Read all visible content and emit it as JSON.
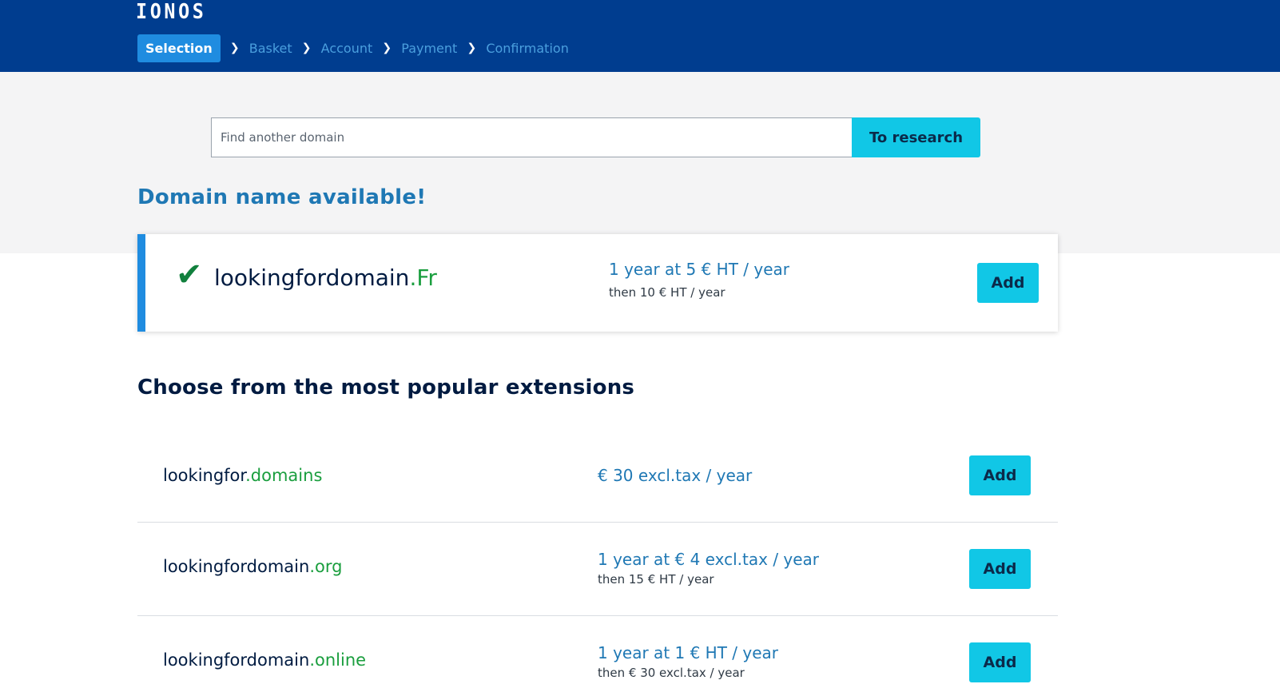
{
  "header": {
    "logo": "IONOS",
    "steps": [
      {
        "label": "Selection",
        "active": true
      },
      {
        "label": "Basket",
        "active": false
      },
      {
        "label": "Account",
        "active": false
      },
      {
        "label": "Payment",
        "active": false
      },
      {
        "label": "Confirmation",
        "active": false
      }
    ],
    "step_separator_icon": "chevron-right-icon"
  },
  "search": {
    "placeholder": "Find another domain",
    "value": "",
    "button_label": "To research"
  },
  "available": {
    "title": "Domain name available!",
    "icon": "check-icon",
    "domain_name": "lookingfordomain",
    "domain_tld": ".Fr",
    "price_main": "1 year at 5 € HT / year",
    "price_sub": "then 10 € HT / year",
    "add_label": "Add"
  },
  "popular": {
    "title": "Choose from the most popular extensions",
    "items": [
      {
        "name": "lookingfor",
        "tld": ".domains",
        "price_main": "€ 30 excl.tax / year",
        "price_sub": "",
        "add_label": "Add"
      },
      {
        "name": "lookingfordomain",
        "tld": ".org",
        "price_main": "1 year at € 4 excl.tax / year",
        "price_sub": "then 15 € HT / year",
        "add_label": "Add"
      },
      {
        "name": "lookingfordomain",
        "tld": ".online",
        "price_main": "1 year at 1 € HT / year",
        "price_sub": "then € 30 excl.tax / year",
        "add_label": "Add"
      }
    ]
  },
  "colors": {
    "header_bg": "#003d8f",
    "accent_cyan": "#11c7e6",
    "active_step": "#1f8ce0",
    "tld_green": "#1a9e3e",
    "price_blue": "#1f78b4"
  }
}
